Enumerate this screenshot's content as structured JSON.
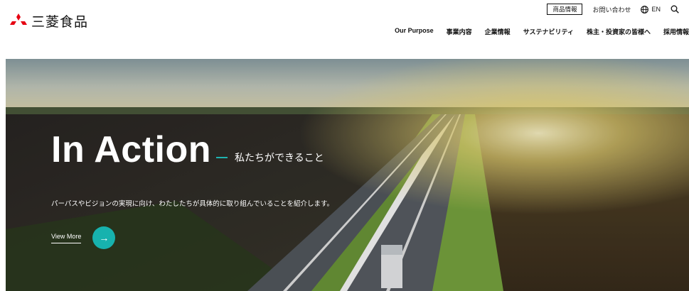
{
  "header": {
    "logo_text": "三菱食品",
    "products_button": "商品情報",
    "contact_link": "お問い合わせ",
    "language": "EN"
  },
  "nav": [
    "Our Purpose",
    "事業内容",
    "企業情報",
    "サステナビリティ",
    "株主・投資家の皆様へ",
    "採用情報"
  ],
  "hero": {
    "title": "In Action",
    "subtitle": "私たちができること",
    "description": "パーパスやビジョンの実現に向け、わたしたちが具体的に取り組んでいることを紹介します。",
    "cta_label": "View More",
    "cta_arrow": "→"
  },
  "colors": {
    "accent": "#17b2ae",
    "logo_red": "#e60012"
  },
  "icons": [
    "logo-diamonds-icon",
    "globe-icon",
    "search-icon",
    "arrow-right-icon"
  ]
}
